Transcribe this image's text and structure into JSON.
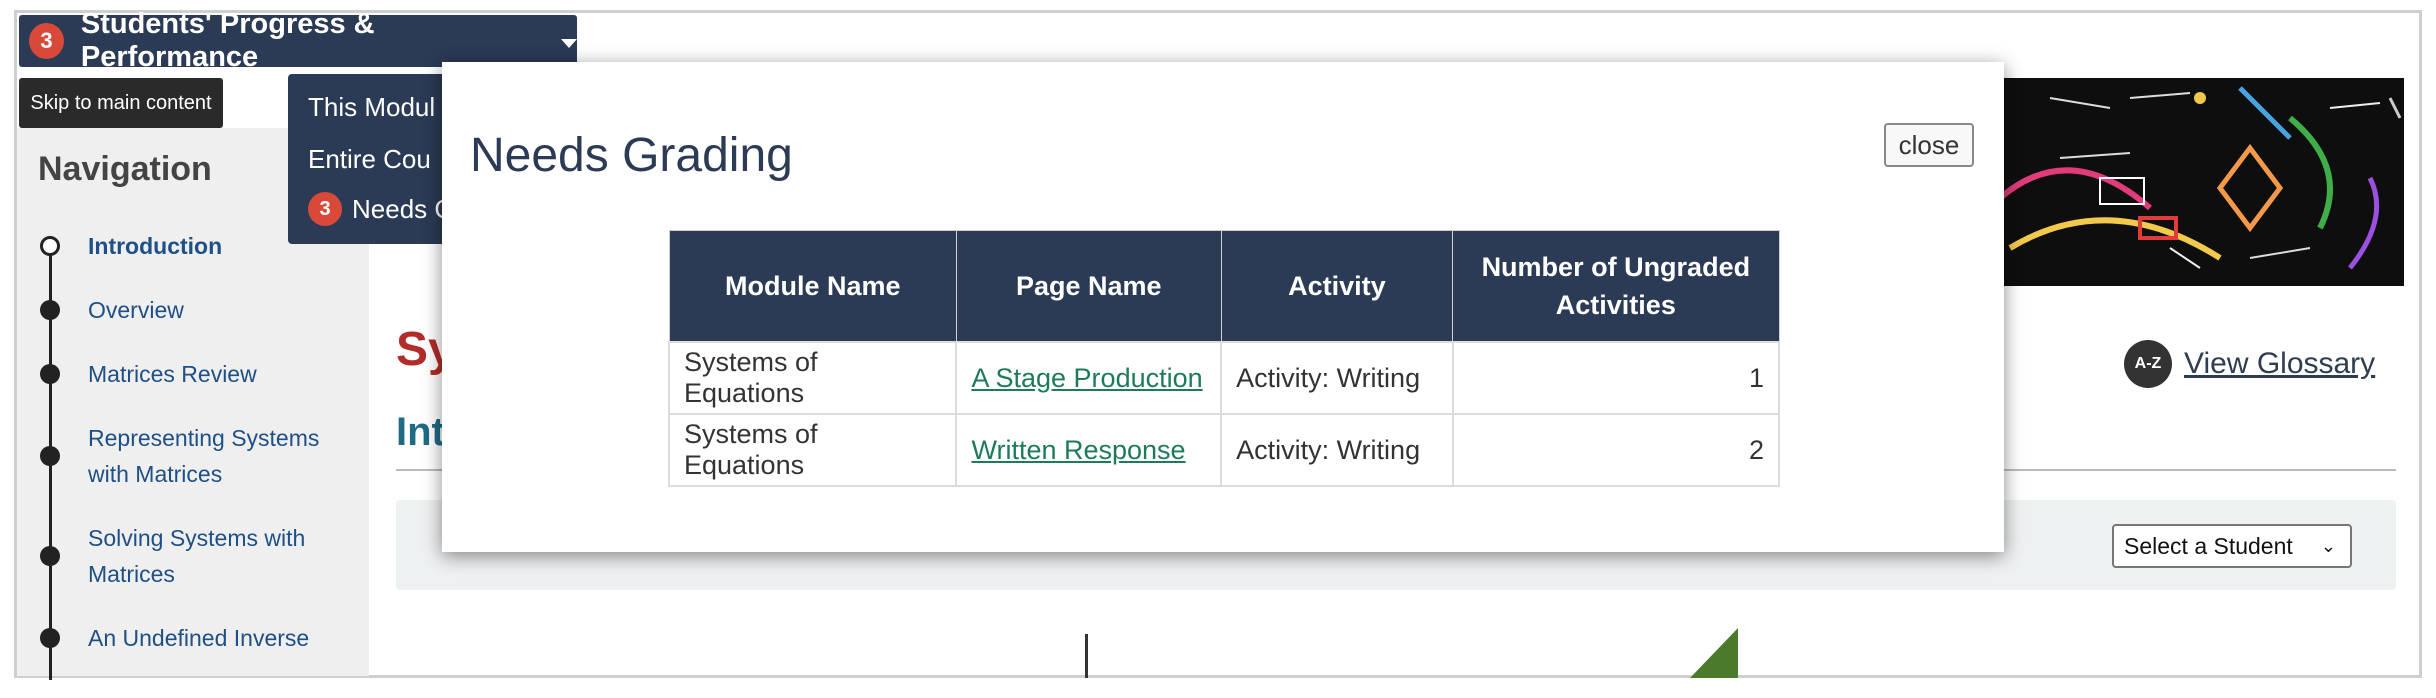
{
  "topbar": {
    "badge_count": "3",
    "title": "Students' Progress & Performance",
    "skip_link": "Skip to main content"
  },
  "dropdown": {
    "items": [
      {
        "label": "This Modul"
      },
      {
        "label": "Entire Cou"
      },
      {
        "label": "Needs G",
        "badge": "3"
      }
    ]
  },
  "sidebar": {
    "title": "Navigation",
    "items": [
      {
        "label": "Introduction",
        "active": true
      },
      {
        "label": "Overview"
      },
      {
        "label": "Matrices Review"
      },
      {
        "label": "Representing Systems with Matrices"
      },
      {
        "label": "Solving Systems with Matrices"
      },
      {
        "label": "An Undefined Inverse"
      }
    ]
  },
  "page": {
    "title_fragment": "Sy",
    "subtitle_fragment": "Int",
    "glossary_icon": "A-Z",
    "glossary_label": "View Glossary",
    "select_student": "Select a Student"
  },
  "modal": {
    "title": "Needs Grading",
    "close_label": "close",
    "columns": [
      "Module Name",
      "Page Name",
      "Activity",
      "Number of Ungraded Activities"
    ],
    "rows": [
      {
        "module": "Systems of Equations",
        "page": "A Stage Production",
        "activity": "Activity: Writing",
        "count": "1"
      },
      {
        "module": "Systems of Equations",
        "page": "Written Response",
        "activity": "Activity: Writing",
        "count": "2"
      }
    ]
  },
  "colors": {
    "navy": "#2b3a55",
    "badge_red": "#d9493a",
    "link_green": "#1d7b5b",
    "nav_link_blue": "#1e4f86",
    "title_red": "#b22c2a"
  }
}
